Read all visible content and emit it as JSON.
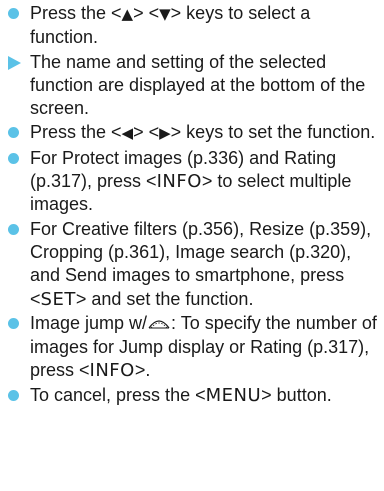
{
  "steps": [
    {
      "marker": "bullet",
      "pre": "Press the <",
      "up": "▲",
      "mid": "> <",
      "down": "▼",
      "post": "> keys to select a function."
    },
    {
      "marker": "arrow",
      "text": "The name and setting of the selected function are displayed at the bottom of the screen."
    },
    {
      "marker": "bullet",
      "pre": "Press the <",
      "left": "◀",
      "mid": "> <",
      "right": "▶",
      "post": "> keys to set the function."
    },
    {
      "marker": "bullet",
      "pre": "For Protect images (p.336) and Rating (p.317), press <",
      "btn": "INFO",
      "post": "> to select multiple images."
    },
    {
      "marker": "bullet",
      "pre": "For Creative filters (p.356), Resize (p.359), Cropping (p.361), Image search (p.320), and Send images to smartphone, press <",
      "btn": "SET",
      "post": "> and set the function."
    },
    {
      "marker": "bullet",
      "pre": "Image jump w/",
      "dial_icon": "main-dial-icon",
      "mid": ": To specify the number of images for Jump display or Rating (p.317), press <",
      "btn": "INFO",
      "post": ">."
    },
    {
      "marker": "bullet",
      "pre": "To cancel, press the <",
      "btn": "MENU",
      "post": "> button."
    }
  ],
  "colors": {
    "bullet": "#5bc2e7",
    "text": "#1a1a1a"
  }
}
